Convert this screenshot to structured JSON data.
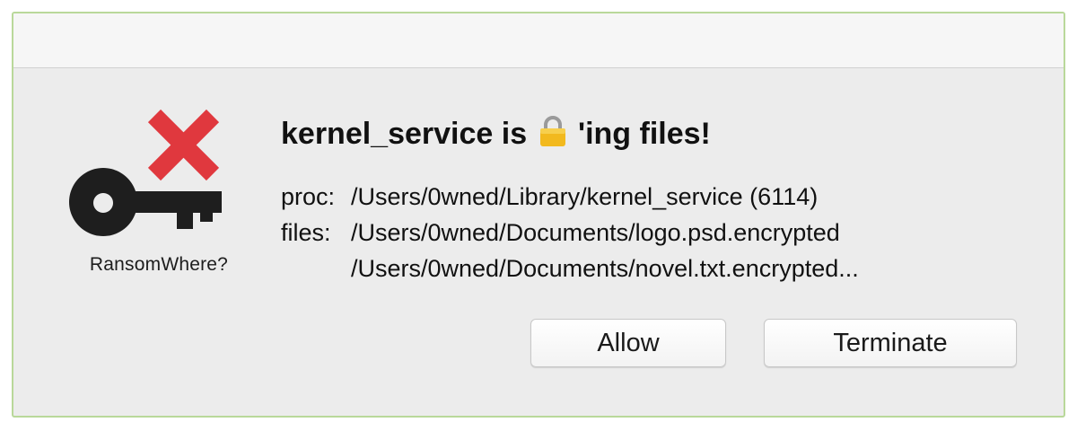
{
  "app": {
    "name": "RansomWhere?",
    "icon": "key-with-x-icon",
    "colors": {
      "x_mark": "#e0383e",
      "key": "#1e1e1e"
    }
  },
  "alert": {
    "title_before_icon": "kernel_service is ",
    "title_icon": "lock-icon",
    "title_after_icon": " 'ing files!",
    "proc_label": "proc:",
    "proc_value": "/Users/0wned/Library/kernel_service (6114)",
    "files_label": "files:",
    "files": [
      "/Users/0wned/Documents/logo.psd.encrypted",
      "/Users/0wned/Documents/novel.txt.encrypted..."
    ]
  },
  "buttons": {
    "allow": "Allow",
    "terminate": "Terminate"
  }
}
